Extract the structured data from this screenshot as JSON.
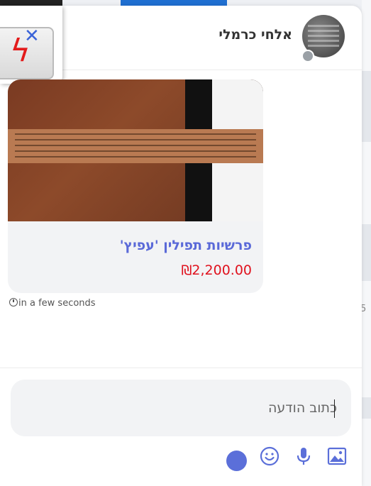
{
  "chat": {
    "contact_name": "אלחי כרמלי",
    "message": {
      "product_title": "פרשיות תפילין 'עפיץ'",
      "product_price": "₪2,200.00",
      "timestamp": "in a few seconds"
    },
    "compose": {
      "placeholder": "כתוב הודעה"
    }
  },
  "background": {
    "side_text": "5"
  },
  "colors": {
    "accent": "#5b6fd9",
    "price": "#e0121e",
    "title": "#5a69d8"
  },
  "icons": [
    "battery-icon",
    "close-icon",
    "avatar",
    "clock-icon",
    "image-icon",
    "microphone-icon",
    "emoji-icon",
    "send-icon"
  ]
}
